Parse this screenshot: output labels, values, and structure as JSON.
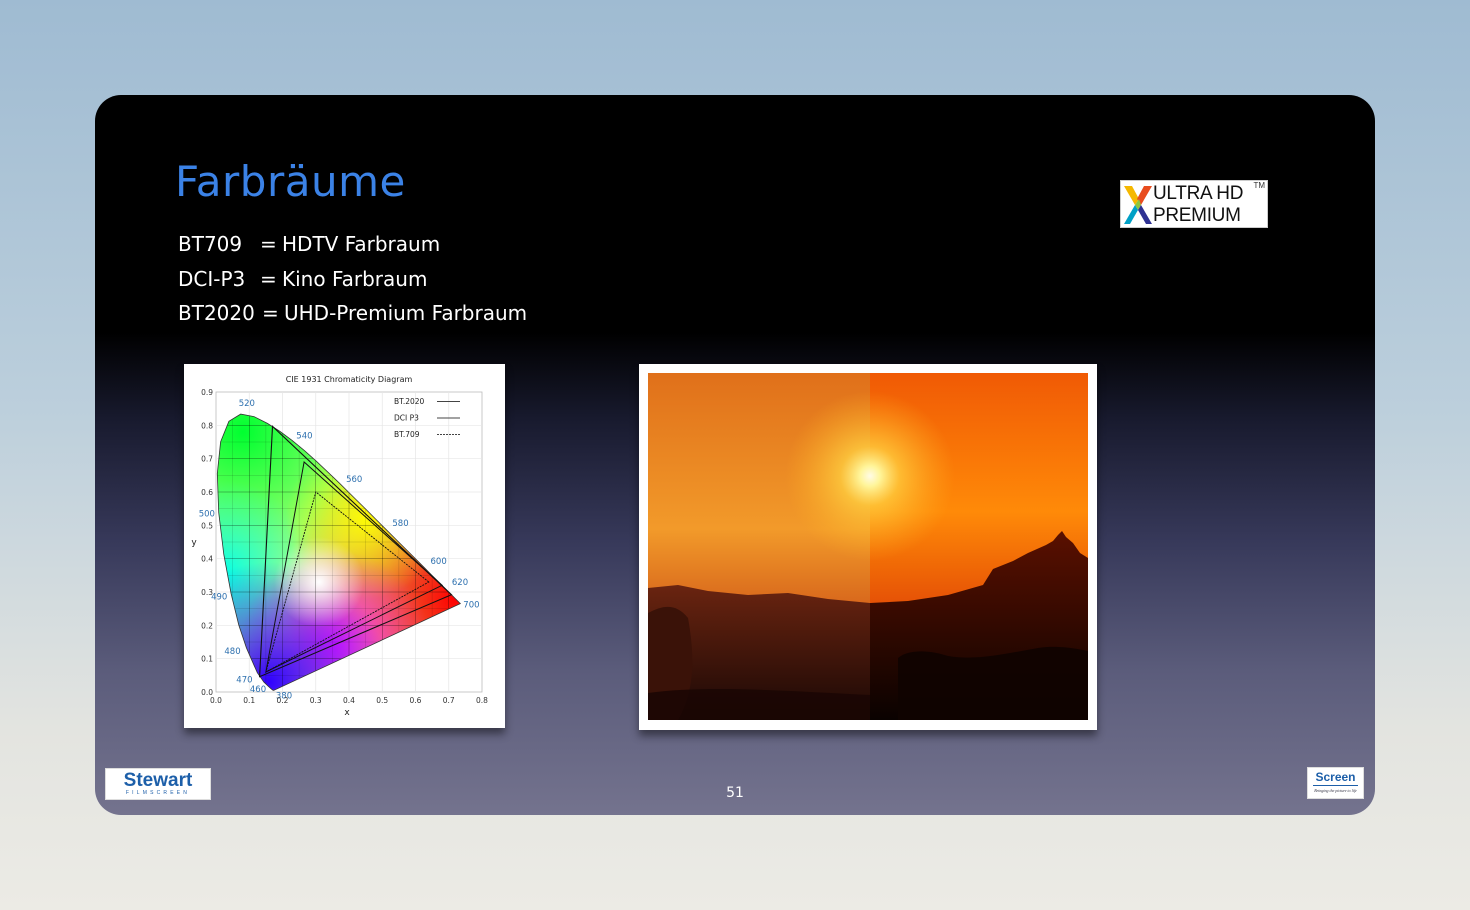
{
  "slide": {
    "title": "Farbräume",
    "definitions": [
      {
        "term": "BT709",
        "eq": "=",
        "desc": "HDTV Farbraum"
      },
      {
        "term": "DCI-P3",
        "eq": "=",
        "desc": "Kino Farbraum"
      },
      {
        "term": "BT2020",
        "eq": "=",
        "desc": "UHD-Premium Farbraum"
      }
    ],
    "page_number": "51"
  },
  "logos": {
    "uhd_line1": "ULTRA HD",
    "uhd_line2": "PREMIUM",
    "uhd_tm": "TM",
    "stewart_name": "Stewart",
    "stewart_sub": "FILMSCREEN",
    "screen_name": "Screen",
    "screen_tagline": "Bringing the picture to life"
  },
  "chart_data": {
    "type": "scatter",
    "title": "CIE 1931 Chromaticity Diagram",
    "xlabel": "x",
    "ylabel": "y",
    "xlim": [
      0.0,
      0.8
    ],
    "ylim": [
      0.0,
      0.9
    ],
    "xticks": [
      "0.0",
      "0.1",
      "0.2",
      "0.3",
      "0.4",
      "0.5",
      "0.6",
      "0.7",
      "0.8"
    ],
    "yticks": [
      "0.0",
      "0.1",
      "0.2",
      "0.3",
      "0.4",
      "0.5",
      "0.6",
      "0.7",
      "0.8",
      "0.9"
    ],
    "grid": true,
    "legend_position": "top-right",
    "spectral_locus": [
      [
        0.1741,
        0.005
      ],
      [
        0.1738,
        0.0049
      ],
      [
        0.1733,
        0.0048
      ],
      [
        0.1726,
        0.0048
      ],
      [
        0.1714,
        0.0051
      ],
      [
        0.1689,
        0.0069
      ],
      [
        0.1644,
        0.0109
      ],
      [
        0.1566,
        0.0177
      ],
      [
        0.144,
        0.0297
      ],
      [
        0.1241,
        0.0578
      ],
      [
        0.0913,
        0.1327
      ],
      [
        0.0687,
        0.2007
      ],
      [
        0.0454,
        0.295
      ],
      [
        0.0235,
        0.4127
      ],
      [
        0.0082,
        0.5384
      ],
      [
        0.0039,
        0.6548
      ],
      [
        0.0139,
        0.7502
      ],
      [
        0.0389,
        0.812
      ],
      [
        0.0743,
        0.8338
      ],
      [
        0.1142,
        0.8262
      ],
      [
        0.1547,
        0.8059
      ],
      [
        0.1929,
        0.7816
      ],
      [
        0.2296,
        0.7543
      ],
      [
        0.2658,
        0.7243
      ],
      [
        0.3016,
        0.6923
      ],
      [
        0.3373,
        0.6589
      ],
      [
        0.3731,
        0.6245
      ],
      [
        0.4087,
        0.5896
      ],
      [
        0.4441,
        0.5547
      ],
      [
        0.4788,
        0.5202
      ],
      [
        0.5125,
        0.4866
      ],
      [
        0.5448,
        0.4544
      ],
      [
        0.5752,
        0.4242
      ],
      [
        0.6029,
        0.3965
      ],
      [
        0.627,
        0.3725
      ],
      [
        0.6482,
        0.3514
      ],
      [
        0.6658,
        0.334
      ],
      [
        0.6801,
        0.3197
      ],
      [
        0.6915,
        0.3083
      ],
      [
        0.7006,
        0.2993
      ],
      [
        0.7079,
        0.292
      ],
      [
        0.714,
        0.2859
      ],
      [
        0.719,
        0.2809
      ],
      [
        0.723,
        0.277
      ],
      [
        0.726,
        0.274
      ],
      [
        0.7283,
        0.2717
      ],
      [
        0.73,
        0.27
      ],
      [
        0.7311,
        0.2689
      ],
      [
        0.732,
        0.268
      ],
      [
        0.7327,
        0.2673
      ],
      [
        0.7334,
        0.2666
      ],
      [
        0.734,
        0.266
      ],
      [
        0.7344,
        0.2656
      ],
      [
        0.7346,
        0.2654
      ],
      [
        0.7347,
        0.2653
      ]
    ],
    "wavelength_labels": [
      {
        "label": "380",
        "x": 0.1741,
        "y": 0.005
      },
      {
        "label": "460",
        "x": 0.144,
        "y": 0.0297
      },
      {
        "label": "470",
        "x": 0.1241,
        "y": 0.0578
      },
      {
        "label": "480",
        "x": 0.0913,
        "y": 0.1327
      },
      {
        "label": "490",
        "x": 0.0454,
        "y": 0.295
      },
      {
        "label": "500",
        "x": 0.0082,
        "y": 0.5384
      },
      {
        "label": "520",
        "x": 0.0743,
        "y": 0.8338
      },
      {
        "label": "540",
        "x": 0.2296,
        "y": 0.7543
      },
      {
        "label": "560",
        "x": 0.3731,
        "y": 0.6245
      },
      {
        "label": "580",
        "x": 0.5125,
        "y": 0.4866
      },
      {
        "label": "600",
        "x": 0.627,
        "y": 0.3725
      },
      {
        "label": "620",
        "x": 0.6915,
        "y": 0.3083
      },
      {
        "label": "700",
        "x": 0.7347,
        "y": 0.2653
      }
    ],
    "series": [
      {
        "name": "BT.2020",
        "points": [
          [
            0.708,
            0.292
          ],
          [
            0.17,
            0.797
          ],
          [
            0.131,
            0.046
          ]
        ]
      },
      {
        "name": "DCI P3",
        "points": [
          [
            0.68,
            0.32
          ],
          [
            0.265,
            0.69
          ],
          [
            0.15,
            0.06
          ]
        ]
      },
      {
        "name": "BT.709",
        "points": [
          [
            0.64,
            0.33
          ],
          [
            0.3,
            0.6
          ],
          [
            0.15,
            0.06
          ]
        ]
      }
    ]
  }
}
